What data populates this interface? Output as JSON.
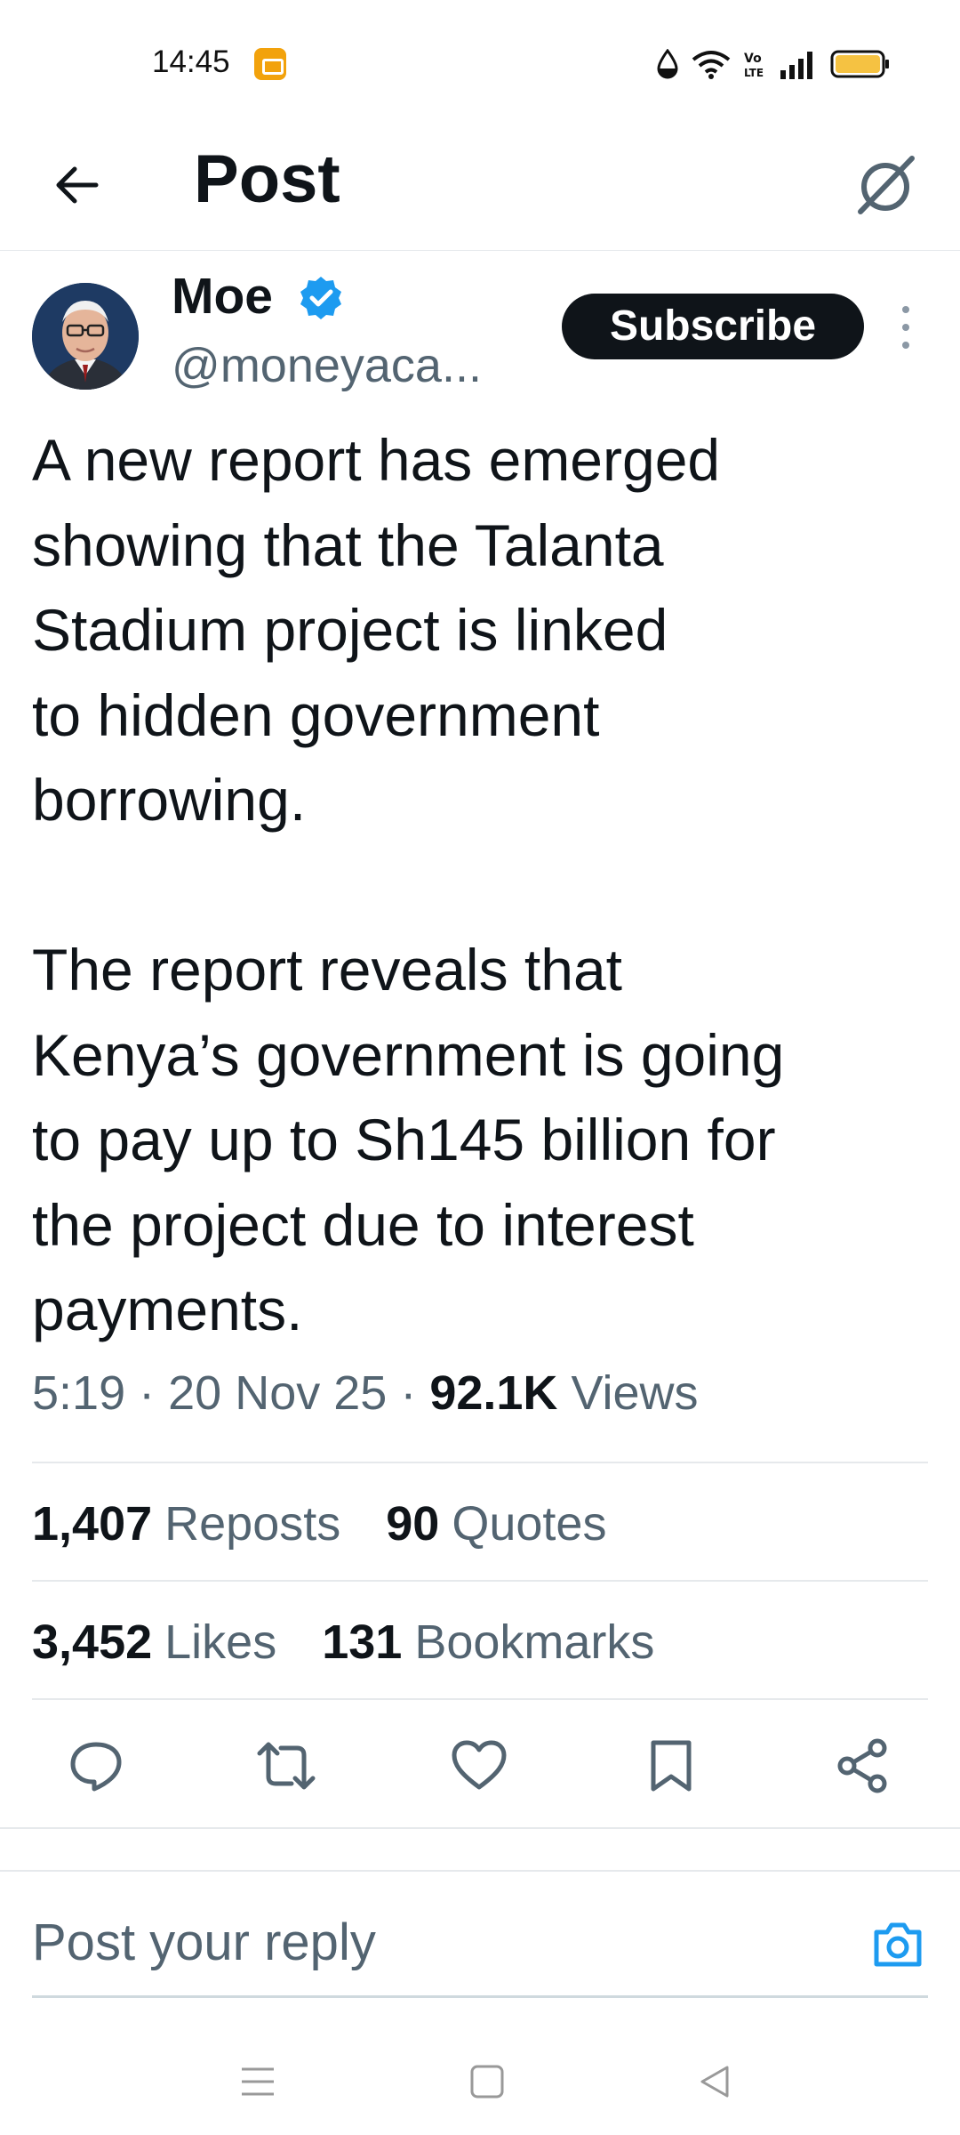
{
  "status_bar": {
    "time": "14:45",
    "icons": [
      "app-notification-icon",
      "dnd-icon",
      "wifi-icon",
      "volte-icon",
      "signal-icon",
      "battery-icon"
    ]
  },
  "header": {
    "title": "Post",
    "back_icon": "arrow-left-icon",
    "grok_icon": "grok-icon"
  },
  "post": {
    "author": {
      "name": "Moe",
      "handle": "@moneyaca...",
      "verified": true
    },
    "subscribe_label": "Subscribe",
    "text": "A new report has emerged\nshowing that the Talanta\nStadium project is linked\nto hidden government\nborrowing.\n\nThe report reveals that\nKenya’s government is going\nto pay up to Sh145 billion for\nthe project due to interest\npayments.",
    "time": "5:19",
    "date": "20 Nov 25",
    "separator": "·",
    "views_count": "92.1K",
    "views_label": "Views"
  },
  "stats": {
    "reposts_count": "1,407",
    "reposts_label": "Reposts",
    "quotes_count": "90",
    "quotes_label": "Quotes",
    "likes_count": "3,452",
    "likes_label": "Likes",
    "bookmarks_count": "131",
    "bookmarks_label": "Bookmarks"
  },
  "actions": [
    "reply-icon",
    "repost-icon",
    "like-icon",
    "bookmark-icon",
    "share-icon"
  ],
  "reply": {
    "placeholder": "Post your reply"
  },
  "colors": {
    "accent": "#1d9bf0",
    "text": "#0f1419",
    "secondary": "#536471",
    "battery": "#f5c242"
  }
}
